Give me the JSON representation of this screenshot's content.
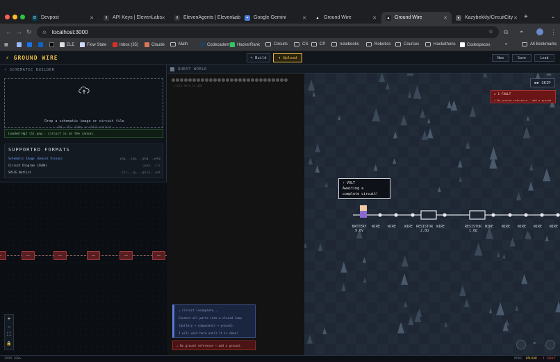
{
  "browser": {
    "tabs": [
      {
        "title": "Devpost",
        "favicon": "D",
        "color": "#003e54"
      },
      {
        "title": "API Keys | ElevenLabs",
        "favicon": "II",
        "color": "#333"
      },
      {
        "title": "ElevenAgents | ElevenLab",
        "favicon": "II",
        "color": "#333"
      },
      {
        "title": "Google Gemini",
        "favicon": "✦",
        "color": "#4a7bd8"
      },
      {
        "title": "Ground Wire",
        "favicon": "▲",
        "color": "#222"
      },
      {
        "title": "Ground Wire",
        "favicon": "▲",
        "color": "#222"
      },
      {
        "title": "Kazybekkly/CircuitCity",
        "favicon": "●",
        "color": "#555"
      }
    ],
    "url": "localhost:3000",
    "bookmarks": [
      {
        "label": "ELE",
        "color": "#e0e0e0"
      },
      {
        "label": "Flow State",
        "color": "#cfd8ff"
      },
      {
        "label": "Inbox (35)",
        "color": "#d93025"
      },
      {
        "label": "Claude",
        "color": "#d97757"
      },
      {
        "label": "Math",
        "folder": true
      },
      {
        "label": "Codecademy",
        "color": "#1f4056"
      },
      {
        "label": "HackerRank",
        "color": "#2ec866"
      },
      {
        "label": "Circuits",
        "folder": true
      },
      {
        "label": "CS",
        "folder": true
      },
      {
        "label": "CP",
        "folder": true
      },
      {
        "label": "notebooks",
        "folder": true
      },
      {
        "label": "Robotics",
        "folder": true
      },
      {
        "label": "Courses",
        "folder": true
      },
      {
        "label": "Hackathons",
        "folder": true
      },
      {
        "label": "Codespaces",
        "color": "#fff"
      }
    ],
    "all_bookmarks": "All Bookmarks",
    "more": "»"
  },
  "app": {
    "logo": "⚡ GROUND WIRE",
    "modes": {
      "build": "✎ Build",
      "upload": "⬆ Upload"
    },
    "actions": {
      "new": "New",
      "save": "Save",
      "load": "Load"
    }
  },
  "left": {
    "title": "⚡ SCHEMATIC BUILDER",
    "drop_title": "Drop a schematic image or circuit file",
    "drop_sub": "PNG, JPG, JSON, or SPICE netlist",
    "loaded": "Loaded Hg2 (1).png · circuit is on the canvas.",
    "formats_title": "SUPPORTED FORMATS",
    "formats": [
      {
        "name": "Schematic Image (Gemini Vision)",
        "ext": ".png, .jpg, .jpeg, .webp",
        "highlight": true
      },
      {
        "name": "Circuit Diagram (JSON)",
        "ext": ".json, .cir",
        "highlight": false
      },
      {
        "name": "SPICE Netlist",
        "ext": ".cir, .sp, .spice, .net",
        "highlight": false
      }
    ],
    "chip_label": "—",
    "zoom": {
      "plus": "+",
      "minus": "−",
      "fit": "⛶",
      "lock": "🔒"
    }
  },
  "quest": {
    "title": "QUEST WORLD",
    "hint": "click here to add",
    "status_lines": [
      "⚠ Circuit incomplete...",
      "Connect all parts into a closed loop",
      "(battery → components → ground).",
      "I will wait here until it is done!"
    ],
    "error": "⚠ No ground reference — add a ground."
  },
  "world": {
    "skip": "▶▶ SKIP",
    "fault_title": "✕ 1 FAULT",
    "fault_detail": "✕ No ground reference — add a ground.",
    "speech_name": "› VOLT",
    "speech_l1": "Awaiting a",
    "speech_l2": "complete circuit!",
    "components": [
      {
        "label": "BATTERY",
        "value": "9.0V"
      },
      {
        "label": "WIRE",
        "value": ""
      },
      {
        "label": "WIRE",
        "value": ""
      },
      {
        "label": "WIRE",
        "value": ""
      },
      {
        "label": "RESISTOR",
        "value": "2.0Ω"
      },
      {
        "label": "WIRE",
        "value": ""
      },
      {
        "label": "RESISTOR",
        "value": "1.0Ω"
      },
      {
        "label": "WIRE",
        "value": ""
      },
      {
        "label": "WIRE",
        "value": ""
      },
      {
        "label": "WIRE",
        "value": ""
      },
      {
        "label": "WIRE",
        "value": ""
      },
      {
        "label": "WIRE",
        "value": ""
      }
    ]
  },
  "footer": {
    "left": "ZOOM 100%",
    "mode_label": "MODE: ",
    "mode": "UPLOAD",
    "faults": "1 FAULT"
  }
}
